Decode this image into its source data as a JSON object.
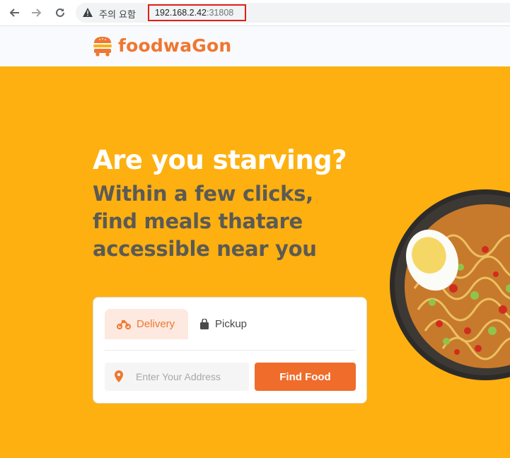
{
  "browser": {
    "security_warning": "주의 요함",
    "url_host": "192.168.2.42",
    "url_port": ":31808",
    "icons": {
      "back": "arrow-left-icon",
      "forward": "arrow-right-icon",
      "reload": "reload-icon",
      "warning": "warning-triangle-icon"
    }
  },
  "site": {
    "logo_text": "foodwaGon",
    "brand_color": "#ef7730"
  },
  "hero": {
    "headline": "Are you starving?",
    "subline": "Within a few clicks, find meals thatare accessible near you",
    "background": "#fdb00f",
    "tabs": [
      {
        "label": "Delivery",
        "icon": "motorbike-icon",
        "active": true
      },
      {
        "label": "Pickup",
        "icon": "shopping-bag-icon",
        "active": false
      }
    ],
    "address_placeholder": "Enter Your Address",
    "find_button": "Find Food"
  }
}
